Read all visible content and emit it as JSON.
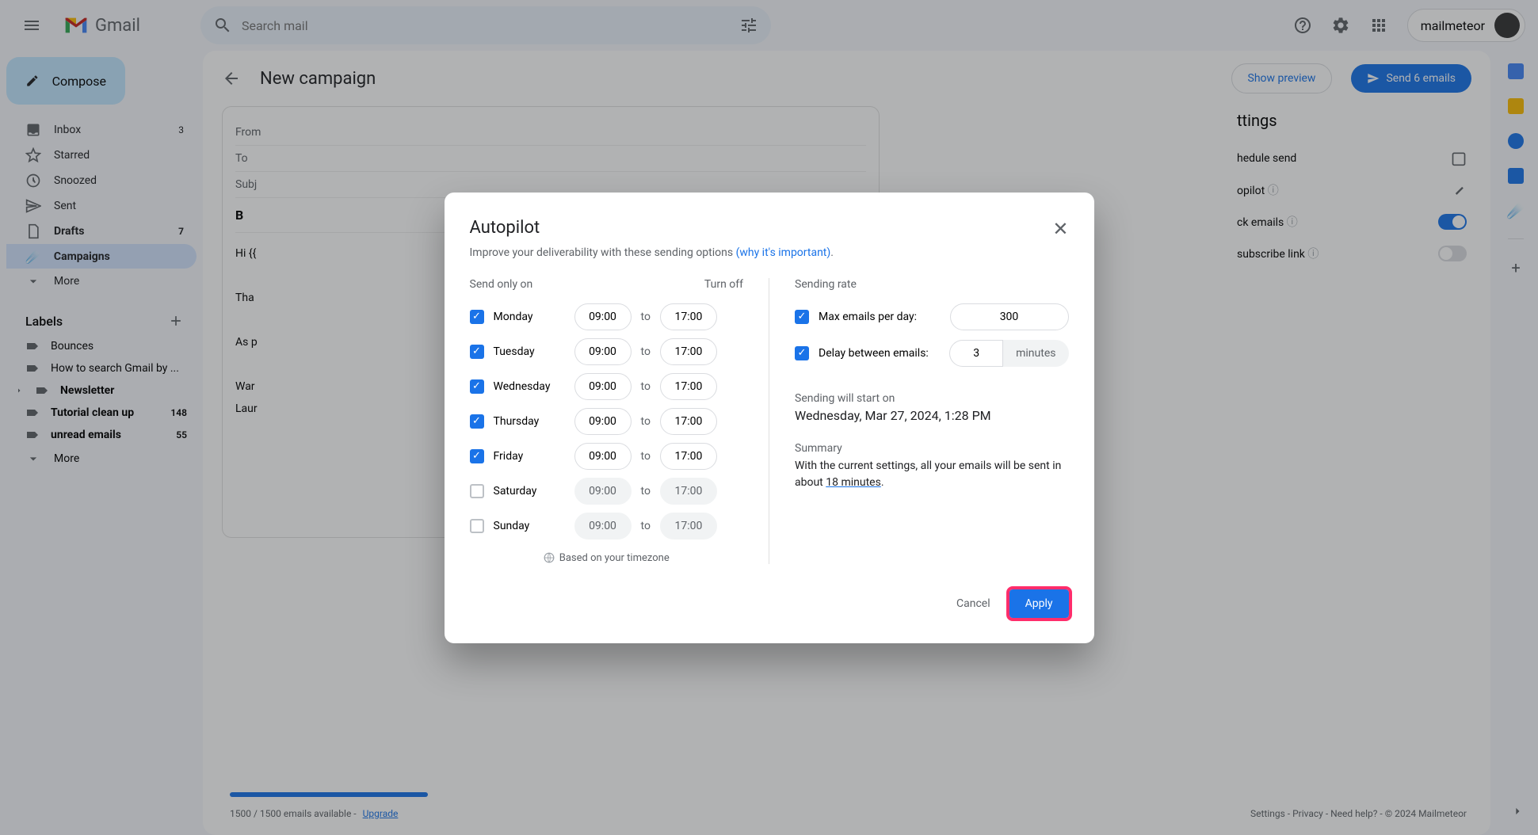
{
  "header": {
    "app_name": "Gmail",
    "search_placeholder": "Search mail",
    "account_name": "mailmeteor"
  },
  "sidebar": {
    "compose": "Compose",
    "items": [
      {
        "label": "Inbox",
        "count": "3"
      },
      {
        "label": "Starred",
        "count": ""
      },
      {
        "label": "Snoozed",
        "count": ""
      },
      {
        "label": "Sent",
        "count": ""
      },
      {
        "label": "Drafts",
        "count": "7"
      },
      {
        "label": "Campaigns",
        "count": ""
      },
      {
        "label": "More",
        "count": ""
      }
    ],
    "labels_header": "Labels",
    "labels": [
      {
        "label": "Bounces",
        "count": "",
        "bold": false
      },
      {
        "label": "How to search Gmail by ...",
        "count": "",
        "bold": false
      },
      {
        "label": "Newsletter",
        "count": "",
        "bold": true
      },
      {
        "label": "Tutorial clean up",
        "count": "148",
        "bold": true
      },
      {
        "label": "unread emails",
        "count": "55",
        "bold": true
      },
      {
        "label": "More",
        "count": "",
        "bold": false
      }
    ]
  },
  "main": {
    "title": "New campaign",
    "show_preview": "Show preview",
    "send_button": "Send 6 emails",
    "from_label": "From",
    "to_label": "To",
    "subject_label": "Subj",
    "body_preview_1": "Hi {{",
    "body_preview_2": "Tha",
    "body_preview_3": "As p",
    "body_preview_4": "War",
    "body_preview_5": "Laur"
  },
  "settings": {
    "title": "ttings",
    "schedule": "hedule send",
    "autopilot": "opilot",
    "track": "ck emails",
    "unsubscribe": "subscribe link"
  },
  "modal": {
    "title": "Autopilot",
    "subtitle_text": "Improve your deliverability with these sending options ",
    "subtitle_link": "(why it's important)",
    "send_only_on": "Send only on",
    "turn_off": "Turn off",
    "days": [
      {
        "name": "Monday",
        "checked": true,
        "from": "09:00",
        "to": "17:00"
      },
      {
        "name": "Tuesday",
        "checked": true,
        "from": "09:00",
        "to": "17:00"
      },
      {
        "name": "Wednesday",
        "checked": true,
        "from": "09:00",
        "to": "17:00"
      },
      {
        "name": "Thursday",
        "checked": true,
        "from": "09:00",
        "to": "17:00"
      },
      {
        "name": "Friday",
        "checked": true,
        "from": "09:00",
        "to": "17:00"
      },
      {
        "name": "Saturday",
        "checked": false,
        "from": "09:00",
        "to": "17:00"
      },
      {
        "name": "Sunday",
        "checked": false,
        "from": "09:00",
        "to": "17:00"
      }
    ],
    "to_word": "to",
    "timezone": "Based on your timezone",
    "sending_rate": "Sending rate",
    "max_emails_label": "Max emails per day:",
    "max_emails_value": "300",
    "delay_label": "Delay between emails:",
    "delay_value": "3",
    "delay_unit": "minutes",
    "start_label": "Sending will start on",
    "start_date": "Wednesday, Mar 27, 2024, 1:28 PM",
    "summary_label": "Summary",
    "summary_text_1": "With the current settings, all your emails will be sent in about ",
    "summary_duration": "18 minutes",
    "cancel": "Cancel",
    "apply": "Apply"
  },
  "footer": {
    "quota": "1500 / 1500 emails available - ",
    "upgrade": "Upgrade",
    "right": "Settings - Privacy - Need help? - © 2024 Mailmeteor"
  }
}
